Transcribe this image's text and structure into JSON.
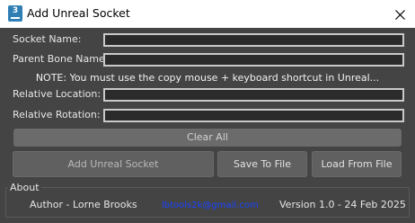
{
  "window": {
    "title": "Add Unreal Socket",
    "app_icon_label": "3",
    "icons": {
      "app": "3dsmax-icon",
      "close": "close-icon"
    }
  },
  "form": {
    "socket_name": {
      "label": "Socket Name:",
      "value": ""
    },
    "parent_bone_name": {
      "label": "Parent Bone Name:",
      "value": ""
    },
    "note": "NOTE: You must use the copy mouse + keyboard shortcut in Unreal...",
    "relative_location": {
      "label": "Relative Location:",
      "value": ""
    },
    "relative_rotation": {
      "label": "Relative Rotation:",
      "value": ""
    }
  },
  "buttons": {
    "clear_all": "Clear All",
    "add_socket": "Add Unreal Socket",
    "save_to_file": "Save To File",
    "load_from_file": "Load From File"
  },
  "about": {
    "title": "About",
    "author": "Author - Lorne Brooks",
    "email": "lbtools2k@gmail.com",
    "version": "Version 1.0 - 24 Feb 2025"
  },
  "colors": {
    "background": "#444444",
    "field_border": "#c9c9c9",
    "link": "#1a45ff",
    "titlebar": "#ffffff"
  }
}
